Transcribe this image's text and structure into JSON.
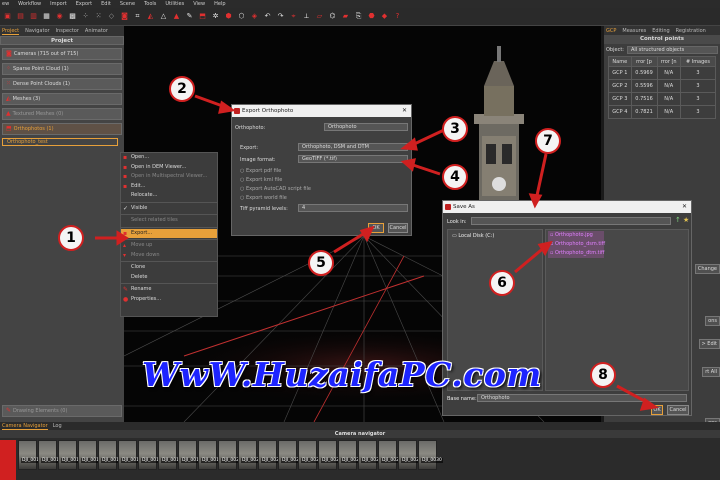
{
  "menu": [
    "ew",
    "Workflow",
    "Import",
    "Export",
    "Edit",
    "Scene",
    "Tools",
    "Utilities",
    "View",
    "Help"
  ],
  "left_panel": {
    "tabs": [
      "Project",
      "Navigator",
      "Inspector",
      "Animator"
    ],
    "header": "Project",
    "items": [
      "Cameras (715 out of 715)",
      "Sparse Point Cloud (1)",
      "Dense Point Clouds (1)",
      "Meshes (3)",
      "Textured Meshes (0)",
      "Orthophotos (1)"
    ],
    "selected_item": "Orthophoto_test",
    "drawing_elements": "Drawing Elements (0)"
  },
  "context_menu": [
    "Open...",
    "Open in DEM Viewer...",
    "Open in Multispectral Viewer...",
    "Edit...",
    "Relocate...",
    "Visible",
    "Select related tiles",
    "Export...",
    "Move up",
    "Move down",
    "Clone",
    "Delete",
    "Rename",
    "Properties..."
  ],
  "export_dialog": {
    "title": "Export Orthophoto",
    "orthophoto_label": "Orthophoto:",
    "orthophoto_value": "Orthophoto",
    "export_label": "Export:",
    "export_value": "Orthophoto, DSM and DTM",
    "format_label": "Image format:",
    "format_value": "GeoTIFF (*.tif)",
    "options": [
      "Export pdf file",
      "Export kml file",
      "Export AutoCAD script file",
      "Export world file"
    ],
    "tiff_label": "Tiff pyramid levels:",
    "tiff_value": "4",
    "ok": "OK",
    "cancel": "Cancel"
  },
  "save_dialog": {
    "title": "Save As",
    "look_in": "Look in:",
    "drive": "Local Disk (C:)",
    "files": [
      "Orthophoto.jpg",
      "Orthophoto_dsm.tiff",
      "Orthophoto_dtm.tiff"
    ],
    "base_name_label": "Base name:",
    "base_name_value": "Orthophoto",
    "ok": "OK",
    "cancel": "Cancel"
  },
  "right_panel": {
    "tabs": [
      "GCP",
      "Measures",
      "Editing",
      "Registration"
    ],
    "title": "Control points",
    "object_label": "Object:",
    "object_value": "All structured objects",
    "columns": [
      "Name",
      "rror [p",
      "rror [n",
      "# Images"
    ],
    "rows": [
      [
        "GCP 1",
        "0.5969",
        "N/A",
        "3"
      ],
      [
        "GCP 2",
        "0.5596",
        "N/A",
        "3"
      ],
      [
        "GCP 3",
        "0.7516",
        "N/A",
        "3"
      ],
      [
        "GCP 4",
        "0.7821",
        "N/A",
        "3"
      ]
    ],
    "side_buttons": [
      "Change",
      "ons",
      "> Edit",
      "rt All",
      "ons"
    ]
  },
  "bottom": {
    "tabs": [
      "Camera Navigator",
      "Log"
    ],
    "title": "Camera navigator",
    "thumbs": [
      "DJI_0010",
      "DJI_0011",
      "DJI_0012",
      "DJI_0013",
      "DJI_0014",
      "DJI_0015",
      "DJI_0016",
      "DJI_0017",
      "DJI_0018",
      "DJI_0019",
      "DJI_0020",
      "DJI_0021",
      "DJI_0022",
      "DJI_0023",
      "DJI_0024",
      "DJI_0025",
      "DJI_0026",
      "DJI_0027",
      "DJI_0028",
      "DJI_0029",
      "DJI_0030"
    ]
  },
  "watermark": "WwW.HuzaifaPC.com",
  "annotations": [
    "1",
    "2",
    "3",
    "4",
    "5",
    "6",
    "7",
    "8"
  ],
  "colors": {
    "accent": "#e7a03a",
    "annotation_red": "#d02020",
    "watermark_blue": "#1d24ff"
  }
}
